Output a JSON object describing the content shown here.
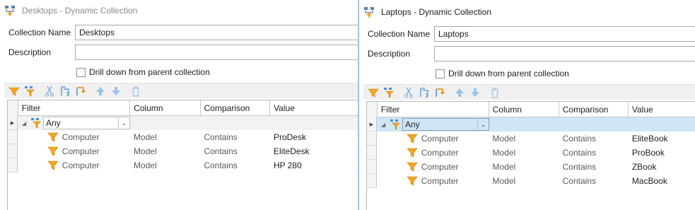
{
  "windows": [
    {
      "title": "Desktops - Dynamic Collection",
      "collection_name_label": "Collection Name",
      "collection_name_value": "Desktops",
      "description_label": "Description",
      "description_value": "",
      "drill_down_label": "Drill down from parent collection",
      "drill_down_checked": false,
      "grid": {
        "columns": [
          "Filter",
          "Column",
          "Comparison",
          "Value"
        ],
        "root": {
          "operator": "Any"
        },
        "rows": [
          {
            "filter": "Computer",
            "column": "Model",
            "comparison": "Contains",
            "value": "ProDesk"
          },
          {
            "filter": "Computer",
            "column": "Model",
            "comparison": "Contains",
            "value": "EliteDesk"
          },
          {
            "filter": "Computer",
            "column": "Model",
            "comparison": "Contains",
            "value": "HP 280"
          }
        ]
      }
    },
    {
      "title": "Laptops - Dynamic Collection",
      "collection_name_label": "Collection Name",
      "collection_name_value": "Laptops",
      "description_label": "Description",
      "description_value": "",
      "drill_down_label": "Drill down from parent collection",
      "drill_down_checked": false,
      "grid": {
        "columns": [
          "Filter",
          "Column",
          "Comparison",
          "Value"
        ],
        "root": {
          "operator": "Any"
        },
        "rows": [
          {
            "filter": "Computer",
            "column": "Model",
            "comparison": "Contains",
            "value": "EliteBook"
          },
          {
            "filter": "Computer",
            "column": "Model",
            "comparison": "Contains",
            "value": "ProBook"
          },
          {
            "filter": "Computer",
            "column": "Model",
            "comparison": "Contains",
            "value": "ZBook"
          },
          {
            "filter": "Computer",
            "column": "Model",
            "comparison": "Contains",
            "value": "MacBook"
          }
        ]
      }
    }
  ],
  "icons": {
    "title": "dynamic-collection-icon",
    "toolbar": [
      "add-condition-icon",
      "add-group-icon",
      "cut-icon",
      "copy-icon",
      "paste-icon",
      "move-up-icon",
      "move-down-icon",
      "delete-icon"
    ],
    "condition": "filter-funnel-icon",
    "group": "group-funnel-icon"
  },
  "colors": {
    "funnel": "#f5a623",
    "arrow_blue": "#4a90d9",
    "selected_row": "#cfe6f7",
    "inactive_title": "#8a8a8a"
  }
}
